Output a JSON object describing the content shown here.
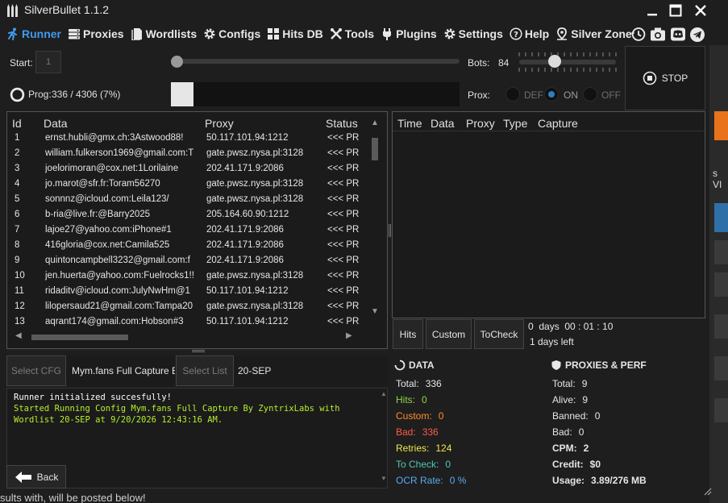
{
  "app": {
    "title": "SilverBullet 1.1.2"
  },
  "nav": [
    {
      "label": "Runner",
      "icon": "runner-icon"
    },
    {
      "label": "Proxies",
      "icon": "proxies-icon"
    },
    {
      "label": "Wordlists",
      "icon": "wordlists-icon"
    },
    {
      "label": "Configs",
      "icon": "gear-icon"
    },
    {
      "label": "Hits DB",
      "icon": "database-icon"
    },
    {
      "label": "Tools",
      "icon": "tools-icon"
    },
    {
      "label": "Plugins",
      "icon": "plug-icon"
    },
    {
      "label": "Settings",
      "icon": "gear-icon"
    },
    {
      "label": "Help",
      "icon": "help-icon"
    },
    {
      "label": "Silver Zone",
      "icon": "location-icon"
    }
  ],
  "controls": {
    "start_label": "Start:",
    "start_value": "1",
    "start_progress": 0.0,
    "bots_label": "Bots:",
    "bots_value": "84",
    "bots_slider": 0.35,
    "stop_label": "STOP",
    "prog_label": "Prog:",
    "prog_value": "336 / 4306 (7%)",
    "prog_fraction": 0.078,
    "prox_label": "Prox:",
    "prox_options": [
      "DEF",
      "ON",
      "OFF"
    ],
    "prox_selected": "ON"
  },
  "data_table": {
    "columns": [
      "Id",
      "Data",
      "Proxy",
      "Status"
    ],
    "rows": [
      {
        "id": "1",
        "data": "ernst.hubli@gmx.ch:3Astwood88!",
        "proxy": "50.117.101.94:1212",
        "status": "<<< PR"
      },
      {
        "id": "2",
        "data": "william.fulkerson1969@gmail.com:T",
        "proxy": "gate.pwsz.nysa.pl:3128",
        "status": "<<< PR"
      },
      {
        "id": "3",
        "data": "joelorimoran@cox.net:1Lorilaine",
        "proxy": "202.41.171.9:2086",
        "status": "<<< PR"
      },
      {
        "id": "4",
        "data": "jo.marot@sfr.fr:Toram56270",
        "proxy": "gate.pwsz.nysa.pl:3128",
        "status": "<<< PR"
      },
      {
        "id": "5",
        "data": "sonnnz@icloud.com:Leila123/",
        "proxy": "gate.pwsz.nysa.pl:3128",
        "status": "<<< PR"
      },
      {
        "id": "6",
        "data": "b-ria@live.fr:@Barry2025",
        "proxy": "205.164.60.90:1212",
        "status": "<<< PR"
      },
      {
        "id": "7",
        "data": "lajoe27@yahoo.com:iPhone#1",
        "proxy": "202.41.171.9:2086",
        "status": "<<< PR"
      },
      {
        "id": "8",
        "data": "416gloria@cox.net:Camila525",
        "proxy": "202.41.171.9:2086",
        "status": "<<< PR"
      },
      {
        "id": "9",
        "data": "quintoncampbell3232@gmail.com:f",
        "proxy": "202.41.171.9:2086",
        "status": "<<< PR"
      },
      {
        "id": "10",
        "data": "jen.huerta@yahoo.com:Fuelrocks1!!",
        "proxy": "gate.pwsz.nysa.pl:3128",
        "status": "<<< PR"
      },
      {
        "id": "11",
        "data": "ridaditv@icloud.com:JulyNwHm@1",
        "proxy": "50.117.101.94:1212",
        "status": "<<< PR"
      },
      {
        "id": "12",
        "data": "lilopersaud21@gmail.com:Tampa20",
        "proxy": "gate.pwsz.nysa.pl:3128",
        "status": "<<< PR"
      },
      {
        "id": "13",
        "data": "aqrant174@gmail.com:Hobson#3",
        "proxy": "50.117.101.94:1212",
        "status": "<<< PR"
      }
    ]
  },
  "hits_table": {
    "columns": [
      "Time",
      "Data",
      "Proxy",
      "Type",
      "Capture"
    ]
  },
  "hits_buttons": [
    "Hits",
    "Custom",
    "ToCheck"
  ],
  "timer": {
    "elapsed": "0  days  00 : 01 : 10",
    "left": "1 days left"
  },
  "config": {
    "select_cfg_label": "Select CFG",
    "cfg_name": "Mym.fans Full Capture By",
    "select_list_label": "Select List",
    "list_name": "20-SEP"
  },
  "log": [
    {
      "text": "Runner initialized succesfully!",
      "color": "#ffffff"
    },
    {
      "text": "Started Running Config Mym.fans Full Capture By ZyntrixLabs with",
      "color": "#b6f02c"
    },
    {
      "text": "Wordlist 20-SEP at 9/20/2026 12:43:16 AM.",
      "color": "#b6f02c"
    }
  ],
  "back_label": "Back",
  "data_stats": {
    "header": "DATA",
    "items": [
      {
        "label": "Total:",
        "value": "336",
        "color": "#e6e6e6"
      },
      {
        "label": "Hits:",
        "value": "0",
        "color": "#8bd64b"
      },
      {
        "label": "Custom:",
        "value": "0",
        "color": "#ff8c2a"
      },
      {
        "label": "Bad:",
        "value": "336",
        "color": "#ff5a4a"
      },
      {
        "label": "Retries:",
        "value": "124",
        "color": "#f1e84a"
      },
      {
        "label": "To Check:",
        "value": "0",
        "color": "#4ec9b0"
      },
      {
        "label": "OCR Rate:",
        "value": "0 %",
        "color": "#5aa9f0"
      }
    ]
  },
  "perf_stats": {
    "header": "PROXIES & PERF",
    "items": [
      {
        "label": "Total:",
        "value": "9"
      },
      {
        "label": "Alive:",
        "value": "9"
      },
      {
        "label": "Banned:",
        "value": "0"
      },
      {
        "label": "Bad:",
        "value": "0"
      },
      {
        "label": "CPM:",
        "value": "2"
      },
      {
        "label": "Credit:",
        "value": "$0"
      },
      {
        "label": "Usage:",
        "value": "3.89/276 MB"
      }
    ]
  },
  "background_text": "sults with, will be posted below!",
  "background_side_text": "s VI",
  "colors": {
    "accent": "#3e9bf0",
    "orange": "#e8731a",
    "blue_bg": "#2f6fa8"
  }
}
